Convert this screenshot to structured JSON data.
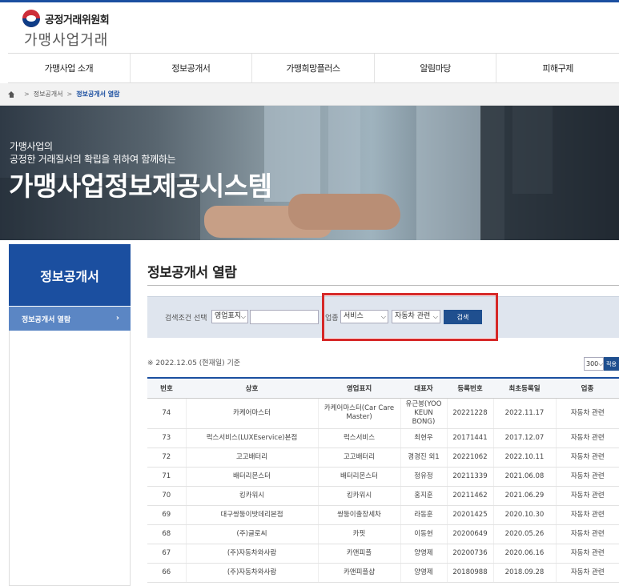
{
  "header": {
    "org_name": "공정거래위원회",
    "site_name": "가맹사업거래"
  },
  "nav": [
    {
      "label": "가맹사업 소개"
    },
    {
      "label": "정보공개서"
    },
    {
      "label": "가맹희망플러스"
    },
    {
      "label": "알림마당"
    },
    {
      "label": "피해구제"
    }
  ],
  "breadcrumb": {
    "items": [
      "정보공개서",
      "정보공개서 열람"
    ]
  },
  "banner": {
    "line1": "가맹사업의",
    "line2": "공정한 거래질서의 확립을 위하여 함께하는",
    "title": "가맹사업정보제공시스템"
  },
  "sidebar": {
    "heading": "정보공개서",
    "items": [
      {
        "label": "정보공개서 열람",
        "arrow": "›"
      }
    ]
  },
  "main": {
    "title": "정보공개서 열람",
    "search": {
      "condition_label": "검색조건 선택",
      "condition_value": "영업표지",
      "keyword_value": "",
      "industry_label": "업종",
      "industry_major": "서비스",
      "industry_minor": "자동차 관련",
      "button": "검색"
    },
    "date_note": "※ 2022.12.05 (현재일) 기준",
    "per_page": "300",
    "apply": "적용",
    "columns": [
      "번호",
      "상호",
      "영업표지",
      "대표자",
      "등록번호",
      "최초등록일",
      "업종"
    ],
    "rows": [
      [
        "74",
        "카케어마스터",
        "카케어마스터(Car Care Master)",
        "유근봉(YOO KEUN BONG)",
        "20221228",
        "2022.11.17",
        "자동차 관련"
      ],
      [
        "73",
        "럭스서비스(LUXEservice)본점",
        "럭스서비스",
        "최현우",
        "20171441",
        "2017.12.07",
        "자동차 관련"
      ],
      [
        "72",
        "고고배터리",
        "고고배터리",
        "경경진 외1",
        "20221062",
        "2022.10.11",
        "자동차 관련"
      ],
      [
        "71",
        "배터리몬스터",
        "배터리몬스터",
        "정유정",
        "20211339",
        "2021.06.08",
        "자동차 관련"
      ],
      [
        "70",
        "킹카워시",
        "킹카워시",
        "홍지훈",
        "20211462",
        "2021.06.29",
        "자동차 관련"
      ],
      [
        "69",
        "대구쌍둥이밧데리본점",
        "쌍둥이출장세차",
        "라동훈",
        "20201425",
        "2020.10.30",
        "자동차 관련"
      ],
      [
        "68",
        "(주)글로씨",
        "카핏",
        "이동현",
        "20200649",
        "2020.05.26",
        "자동차 관련"
      ],
      [
        "67",
        "(주)자동차와사람",
        "카앤피플",
        "양영제",
        "20200736",
        "2020.06.16",
        "자동차 관련"
      ],
      [
        "66",
        "(주)자동차와사람",
        "카앤피플샵",
        "양영제",
        "20180988",
        "2018.09.28",
        "자동차 관련"
      ]
    ]
  }
}
